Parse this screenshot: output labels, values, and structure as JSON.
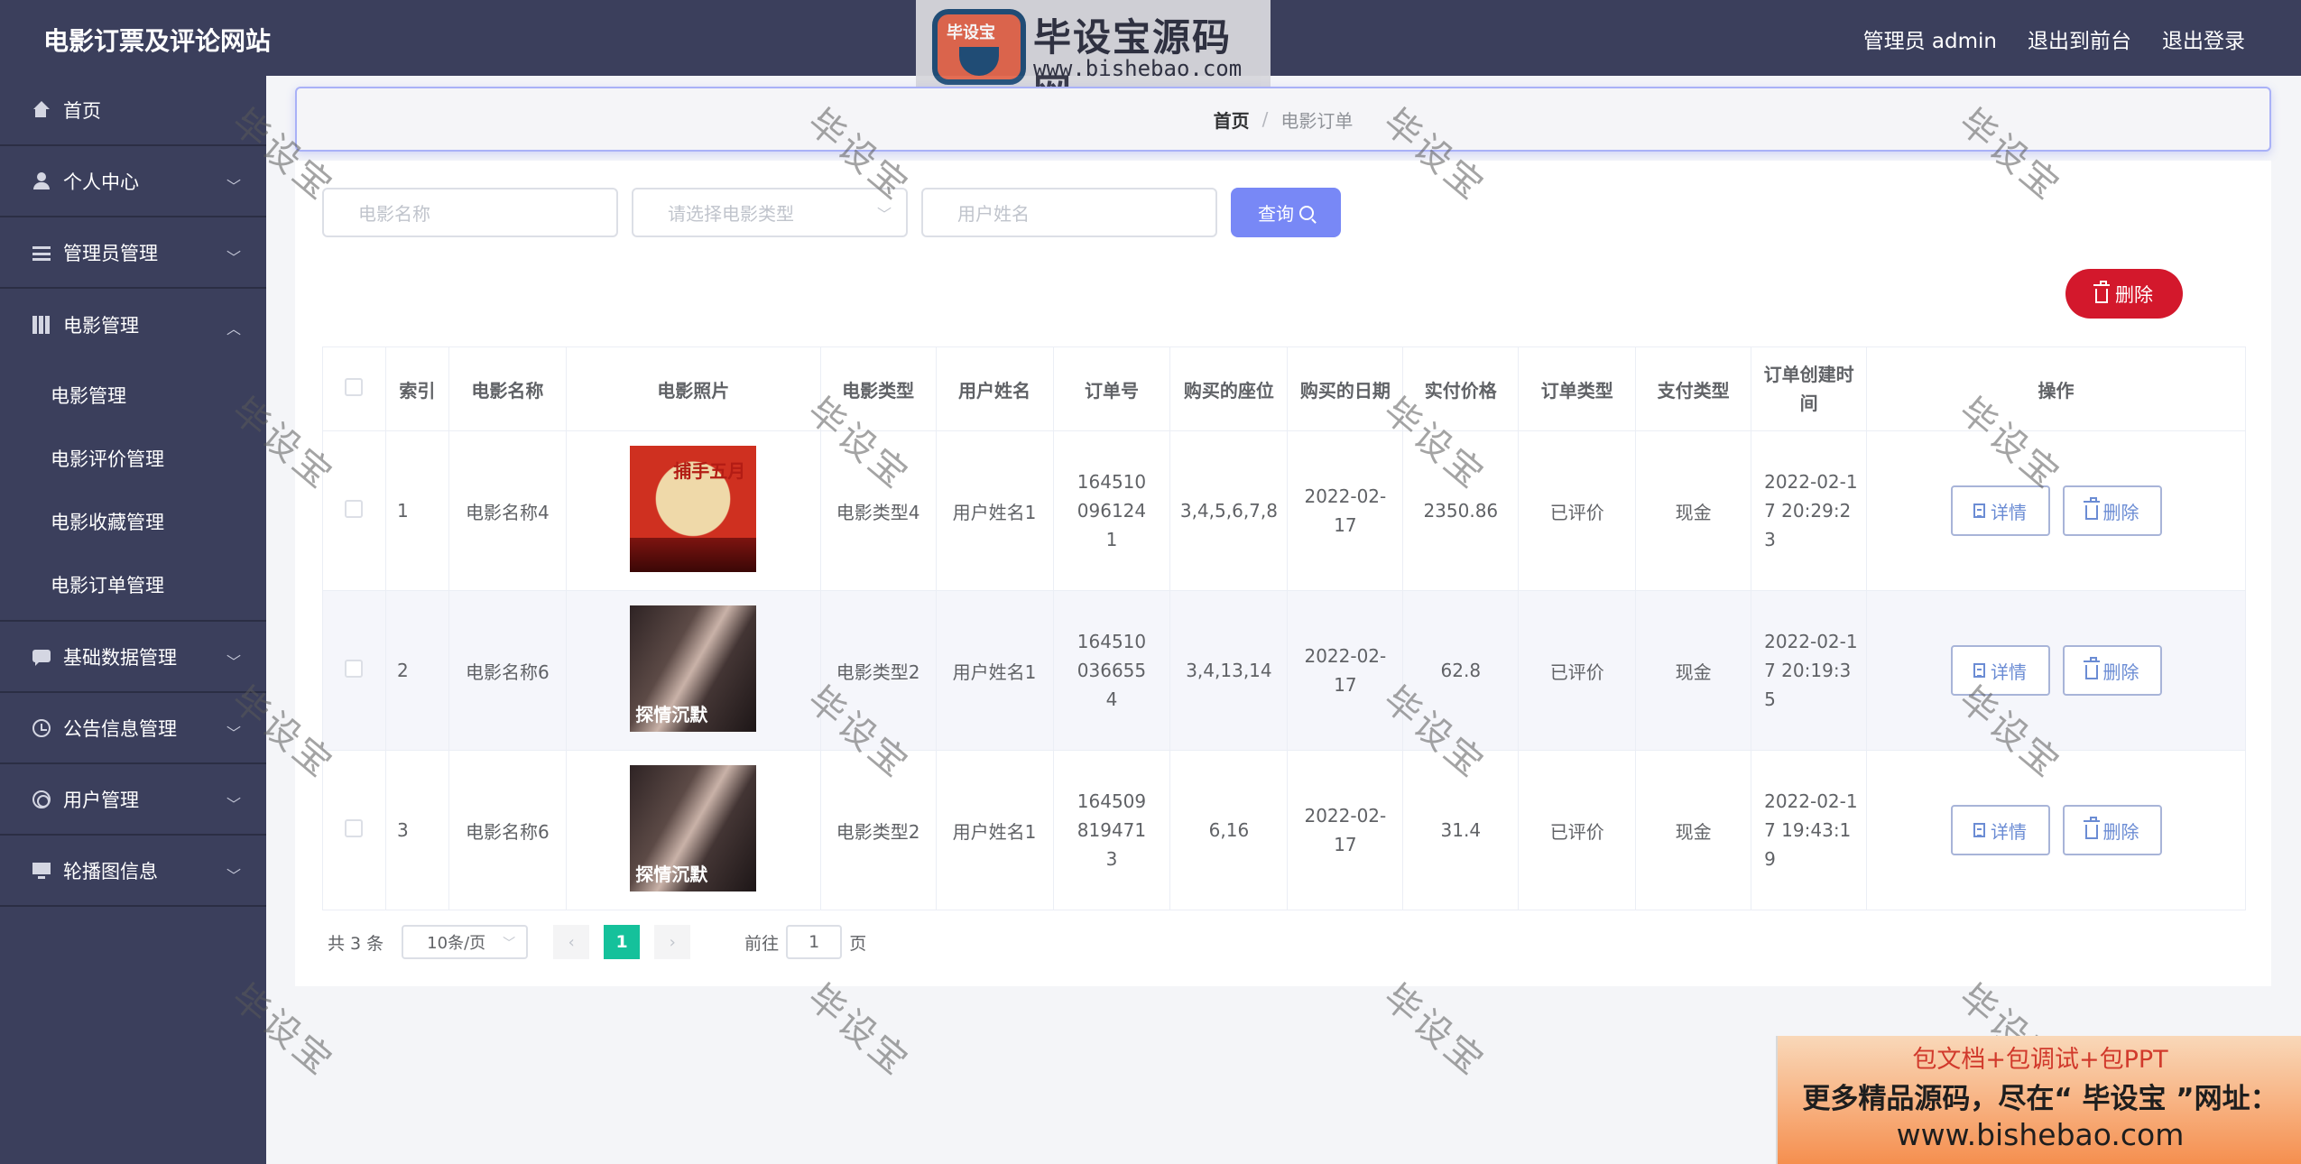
{
  "header": {
    "brand": "电影订票及评论网站",
    "admin_label": "管理员 admin",
    "back_front": "退出到前台",
    "logout": "退出登录"
  },
  "logo_banner": {
    "badge": "毕设宝",
    "title": "毕设宝源码网",
    "url": "www.bishebao.com"
  },
  "sidebar": {
    "home": "首页",
    "personal": "个人中心",
    "admin_mgmt": "管理员管理",
    "movie_mgmt": "电影管理",
    "movie_sub": [
      "电影管理",
      "电影评价管理",
      "电影收藏管理",
      "电影订单管理"
    ],
    "basic_data": "基础数据管理",
    "notice": "公告信息管理",
    "user_mgmt": "用户管理",
    "carousel": "轮播图信息"
  },
  "breadcrumb": {
    "home": "首页",
    "sep": "/",
    "current": "电影订单"
  },
  "filters": {
    "movie_name_placeholder": "电影名称",
    "movie_type_placeholder": "请选择电影类型",
    "user_name_placeholder": "用户姓名",
    "query_label": "查询"
  },
  "delete_label": "删除",
  "table": {
    "headers": [
      "索引",
      "电影名称",
      "电影照片",
      "电影类型",
      "用户姓名",
      "订单号",
      "购买的座位",
      "购买的日期",
      "实付价格",
      "订单类型",
      "支付类型",
      "订单创建时间",
      "操作"
    ],
    "rows": [
      {
        "index": "1",
        "name": "电影名称4",
        "poster_text": "捕手五月",
        "type": "电影类型4",
        "user": "用户姓名1",
        "order_no": "1645100961241",
        "seats": "3,4,5,6,7,8",
        "date": "2022-02-17",
        "price": "2350.86",
        "order_type": "已评价",
        "pay_type": "现金",
        "created": "2022-02-17 20:29:23"
      },
      {
        "index": "2",
        "name": "电影名称6",
        "poster_text": "探情沉默",
        "type": "电影类型2",
        "user": "用户姓名1",
        "order_no": "1645100366554",
        "seats": "3,4,13,14",
        "date": "2022-02-17",
        "price": "62.8",
        "order_type": "已评价",
        "pay_type": "现金",
        "created": "2022-02-17 20:19:35"
      },
      {
        "index": "3",
        "name": "电影名称6",
        "poster_text": "探情沉默",
        "type": "电影类型2",
        "user": "用户姓名1",
        "order_no": "1645098194713",
        "seats": "6,16",
        "date": "2022-02-17",
        "price": "31.4",
        "order_type": "已评价",
        "pay_type": "现金",
        "created": "2022-02-17 19:43:19"
      }
    ],
    "detail_label": "详情",
    "delete_label": "删除"
  },
  "pagination": {
    "total": "共 3 条",
    "page_size": "10条/页",
    "current_page": "1",
    "goto_label": "前往",
    "goto_value": "1",
    "page_suffix": "页"
  },
  "watermark": "毕设宝",
  "promo": {
    "line1": "包文档+包调试+包PPT",
    "line2": "更多精品源码，尽在“ 毕设宝 ”网址：",
    "line3": "www.bishebao.com"
  },
  "colors": {
    "sidebar_bg": "#3b3f5c",
    "query_button": "#7888f6",
    "delete_button": "#d3182c",
    "active_page": "#15c19b"
  }
}
